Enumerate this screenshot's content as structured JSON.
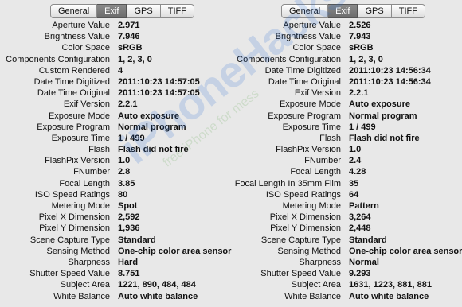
{
  "tabs": [
    "General",
    "Exif",
    "GPS",
    "TIFF"
  ],
  "active_tab": "Exif",
  "watermark": {
    "main": "iPhoneHacks",
    "sub": "free iPhone for mess"
  },
  "left_panel": [
    {
      "key": "Aperture Value",
      "value": "2.971"
    },
    {
      "key": "Brightness Value",
      "value": "7.946"
    },
    {
      "key": "Color Space",
      "value": "sRGB"
    },
    {
      "key": "Components Configuration",
      "value": "1, 2, 3, 0"
    },
    {
      "key": "Custom Rendered",
      "value": "4"
    },
    {
      "key": "Date Time Digitized",
      "value": "2011:10:23 14:57:05"
    },
    {
      "key": "Date Time Original",
      "value": "2011:10:23 14:57:05"
    },
    {
      "key": "Exif Version",
      "value": "2.2.1"
    },
    {
      "key": "Exposure Mode",
      "value": "Auto exposure"
    },
    {
      "key": "Exposure Program",
      "value": "Normal program"
    },
    {
      "key": "Exposure Time",
      "value": "1 / 499"
    },
    {
      "key": "Flash",
      "value": "Flash did not fire"
    },
    {
      "key": "FlashPix Version",
      "value": "1.0"
    },
    {
      "key": "FNumber",
      "value": "2.8"
    },
    {
      "key": "Focal Length",
      "value": "3.85"
    },
    {
      "key": "ISO Speed Ratings",
      "value": "80"
    },
    {
      "key": "Metering Mode",
      "value": "Spot"
    },
    {
      "key": "Pixel X Dimension",
      "value": "2,592"
    },
    {
      "key": "Pixel Y Dimension",
      "value": "1,936"
    },
    {
      "key": "Scene Capture Type",
      "value": "Standard"
    },
    {
      "key": "Sensing Method",
      "value": "One-chip color area sensor"
    },
    {
      "key": "Sharpness",
      "value": "Hard"
    },
    {
      "key": "Shutter Speed Value",
      "value": "8.751"
    },
    {
      "key": "Subject Area",
      "value": "1221, 890, 484, 484"
    },
    {
      "key": "White Balance",
      "value": "Auto white balance"
    }
  ],
  "right_panel": [
    {
      "key": "Aperture Value",
      "value": "2.526"
    },
    {
      "key": "Brightness Value",
      "value": "7.943"
    },
    {
      "key": "Color Space",
      "value": "sRGB"
    },
    {
      "key": "Components Configuration",
      "value": "1, 2, 3, 0"
    },
    {
      "key": "Date Time Digitized",
      "value": "2011:10:23 14:56:34"
    },
    {
      "key": "Date Time Original",
      "value": "2011:10:23 14:56:34"
    },
    {
      "key": "Exif Version",
      "value": "2.2.1"
    },
    {
      "key": "Exposure Mode",
      "value": "Auto exposure"
    },
    {
      "key": "Exposure Program",
      "value": "Normal program"
    },
    {
      "key": "Exposure Time",
      "value": "1 / 499"
    },
    {
      "key": "Flash",
      "value": "Flash did not fire"
    },
    {
      "key": "FlashPix Version",
      "value": "1.0"
    },
    {
      "key": "FNumber",
      "value": "2.4"
    },
    {
      "key": "Focal Length",
      "value": "4.28"
    },
    {
      "key": "Focal Length In 35mm Film",
      "value": "35"
    },
    {
      "key": "ISO Speed Ratings",
      "value": "64"
    },
    {
      "key": "Metering Mode",
      "value": "Pattern"
    },
    {
      "key": "Pixel X Dimension",
      "value": "3,264"
    },
    {
      "key": "Pixel Y Dimension",
      "value": "2,448"
    },
    {
      "key": "Scene Capture Type",
      "value": "Standard"
    },
    {
      "key": "Sensing Method",
      "value": "One-chip color area sensor"
    },
    {
      "key": "Sharpness",
      "value": "Normal"
    },
    {
      "key": "Shutter Speed Value",
      "value": "9.293"
    },
    {
      "key": "Subject Area",
      "value": "1631, 1223, 881, 881"
    },
    {
      "key": "White Balance",
      "value": "Auto white balance"
    }
  ]
}
